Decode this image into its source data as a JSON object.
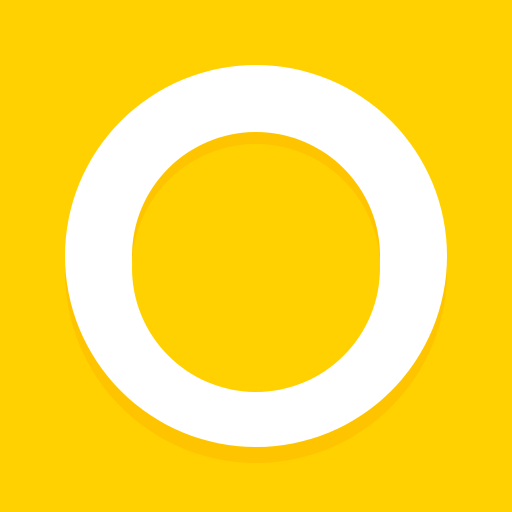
{
  "icon": {
    "name": "ring-logo",
    "colors": {
      "background": "#FFD100",
      "ring": "#FFFFFF",
      "shadow": "#FFC400"
    }
  }
}
